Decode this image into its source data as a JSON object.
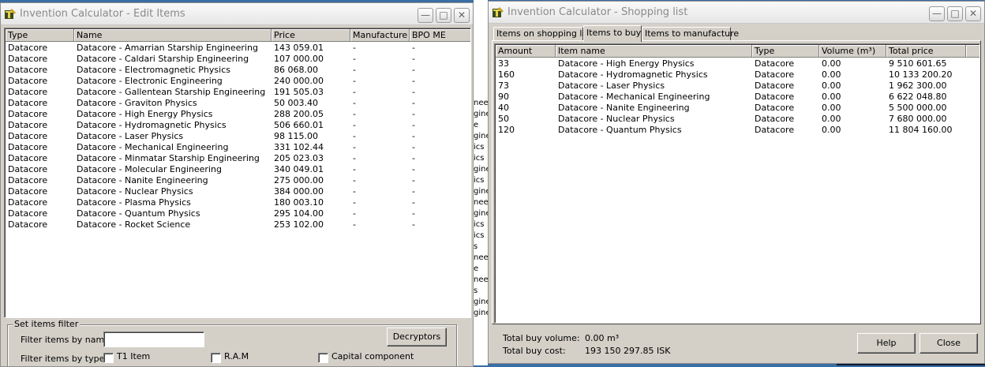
{
  "desktop_strip": [
    "nee",
    "gine",
    "e",
    "gine",
    "ics",
    "ics",
    "gine",
    "ics",
    "gine",
    "nee",
    "gine",
    "ics",
    "ics",
    "s",
    "nee",
    "e",
    "nee",
    "s",
    "gine",
    "gine"
  ],
  "edit_window": {
    "title": "Invention Calculator - Edit Items",
    "columns": [
      "Type",
      "Name",
      "Price",
      "Manufacture",
      "BPO ME"
    ],
    "rows": [
      [
        "Datacore",
        "Datacore - Amarrian Starship Engineering",
        "143 059.01",
        "-",
        "-"
      ],
      [
        "Datacore",
        "Datacore - Caldari Starship Engineering",
        "107 000.00",
        "-",
        "-"
      ],
      [
        "Datacore",
        "Datacore - Electromagnetic Physics",
        "86 068.00",
        "-",
        "-"
      ],
      [
        "Datacore",
        "Datacore - Electronic Engineering",
        "240 000.00",
        "-",
        "-"
      ],
      [
        "Datacore",
        "Datacore - Gallentean Starship Engineering",
        "191 505.03",
        "-",
        "-"
      ],
      [
        "Datacore",
        "Datacore - Graviton Physics",
        "50 003.40",
        "-",
        "-"
      ],
      [
        "Datacore",
        "Datacore - High Energy Physics",
        "288 200.05",
        "-",
        "-"
      ],
      [
        "Datacore",
        "Datacore - Hydromagnetic Physics",
        "506 660.01",
        "-",
        "-"
      ],
      [
        "Datacore",
        "Datacore - Laser Physics",
        "98 115.00",
        "-",
        "-"
      ],
      [
        "Datacore",
        "Datacore - Mechanical Engineering",
        "331 102.44",
        "-",
        "-"
      ],
      [
        "Datacore",
        "Datacore - Minmatar Starship Engineering",
        "205 023.03",
        "-",
        "-"
      ],
      [
        "Datacore",
        "Datacore - Molecular Engineering",
        "340 049.01",
        "-",
        "-"
      ],
      [
        "Datacore",
        "Datacore - Nanite Engineering",
        "275 000.00",
        "-",
        "-"
      ],
      [
        "Datacore",
        "Datacore - Nuclear Physics",
        "384 000.00",
        "-",
        "-"
      ],
      [
        "Datacore",
        "Datacore - Plasma Physics",
        "180 003.10",
        "-",
        "-"
      ],
      [
        "Datacore",
        "Datacore - Quantum Physics",
        "295 104.00",
        "-",
        "-"
      ],
      [
        "Datacore",
        "Datacore - Rocket Science",
        "253 102.00",
        "-",
        "-"
      ]
    ],
    "filter": {
      "group_label": "Set items filter",
      "by_name_label": "Filter items by name:",
      "by_name_value": "",
      "by_type_label": "Filter items by type:",
      "decryptors_button": "Decryptors",
      "types": [
        {
          "label": "T1 Item",
          "checked": false
        },
        {
          "label": "R.A.M",
          "checked": false
        },
        {
          "label": "Capital component",
          "checked": false
        }
      ]
    }
  },
  "shop_window": {
    "title": "Invention Calculator - Shopping list",
    "tabs": [
      "Items on shopping list",
      "Items to buy",
      "Items to manufacture"
    ],
    "active_tab": 1,
    "columns": [
      "Amount",
      "Item name",
      "Type",
      "Volume (m³)",
      "Total price"
    ],
    "rows": [
      [
        "33",
        "Datacore - High Energy Physics",
        "Datacore",
        "0.00",
        "9 510 601.65"
      ],
      [
        "160",
        "Datacore - Hydromagnetic Physics",
        "Datacore",
        "0.00",
        "10 133 200.20"
      ],
      [
        "73",
        "Datacore - Laser Physics",
        "Datacore",
        "0.00",
        "1 962 300.00"
      ],
      [
        "90",
        "Datacore - Mechanical Engineering",
        "Datacore",
        "0.00",
        "6 622 048.80"
      ],
      [
        "40",
        "Datacore - Nanite Engineering",
        "Datacore",
        "0.00",
        "5 500 000.00"
      ],
      [
        "50",
        "Datacore - Nuclear Physics",
        "Datacore",
        "0.00",
        "7 680 000.00"
      ],
      [
        "120",
        "Datacore - Quantum Physics",
        "Datacore",
        "0.00",
        "11 804 160.00"
      ]
    ],
    "summary": {
      "volume_label": "Total buy volume:",
      "volume_value": "0.00 m³",
      "cost_label": "Total buy cost:",
      "cost_value": "193 150 297.85 ISK"
    },
    "help_button": "Help",
    "close_button": "Close"
  },
  "icons": {
    "app": "invention-calculator-icon",
    "minimize": "minimize-icon",
    "maximize": "maximize-icon",
    "close": "close-icon"
  }
}
